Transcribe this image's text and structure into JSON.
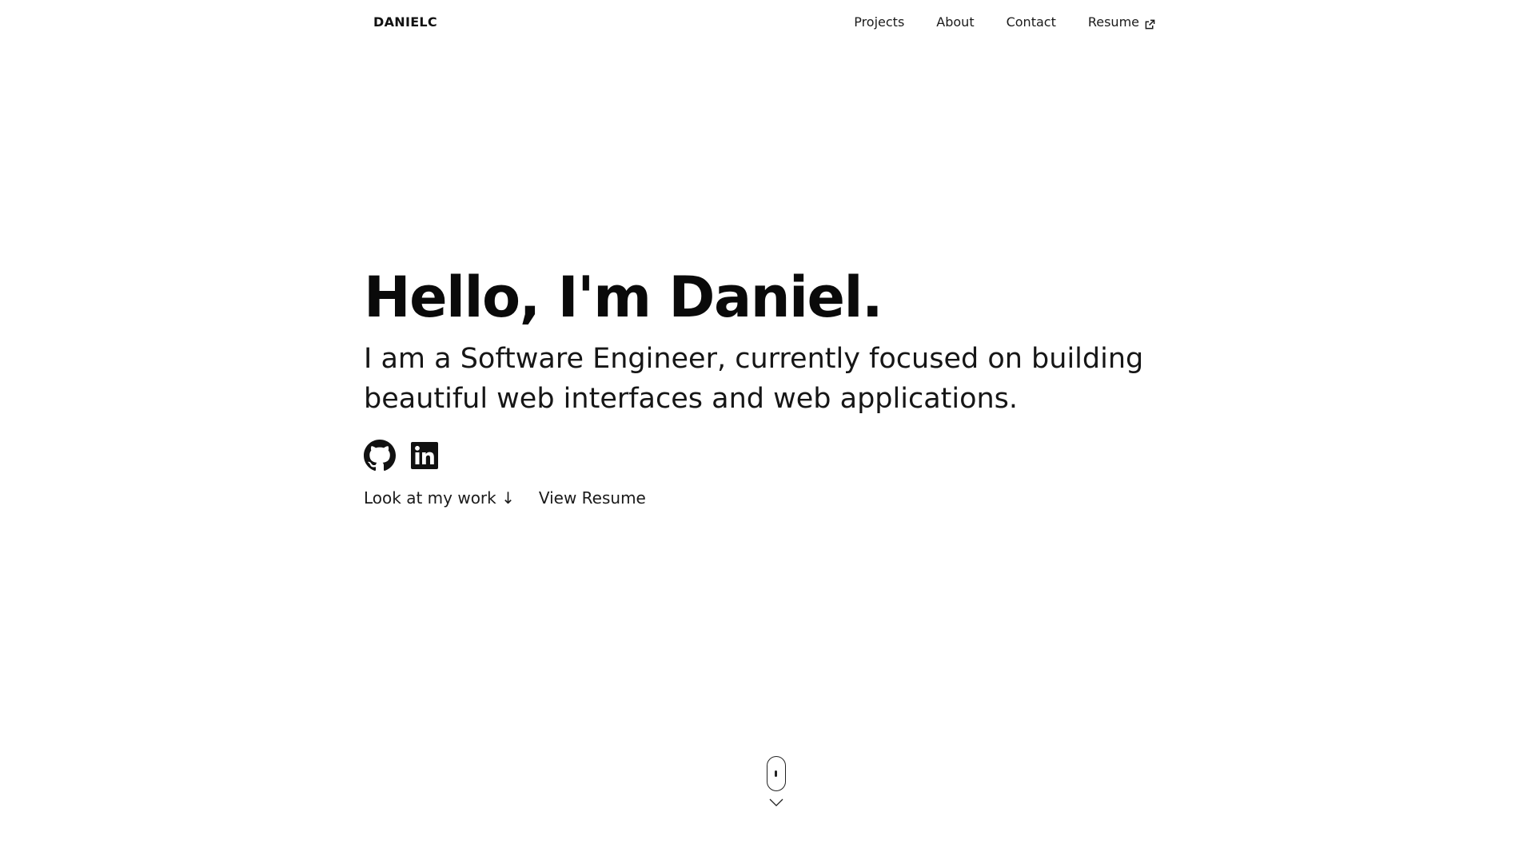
{
  "nav": {
    "brand": "DANIELC",
    "links": [
      {
        "label": "Projects"
      },
      {
        "label": "About"
      },
      {
        "label": "Contact"
      },
      {
        "label": "Resume",
        "icon": "external-link-icon"
      }
    ]
  },
  "hero": {
    "title": "Hello, I'm Daniel.",
    "subtitle": "I am a Software Engineer, currently focused on building beautiful web interfaces and web applications.",
    "social": [
      {
        "icon": "github-icon"
      },
      {
        "icon": "linkedin-icon"
      }
    ],
    "actions": {
      "work_label": "Look at my work ↓",
      "resume_label": "View Resume"
    }
  },
  "scroll_indicator": {
    "icons": [
      "mouse-icon",
      "chevron-down-icon"
    ]
  },
  "colors": {
    "background": "#ffffff",
    "text": "#0a0a0a"
  }
}
